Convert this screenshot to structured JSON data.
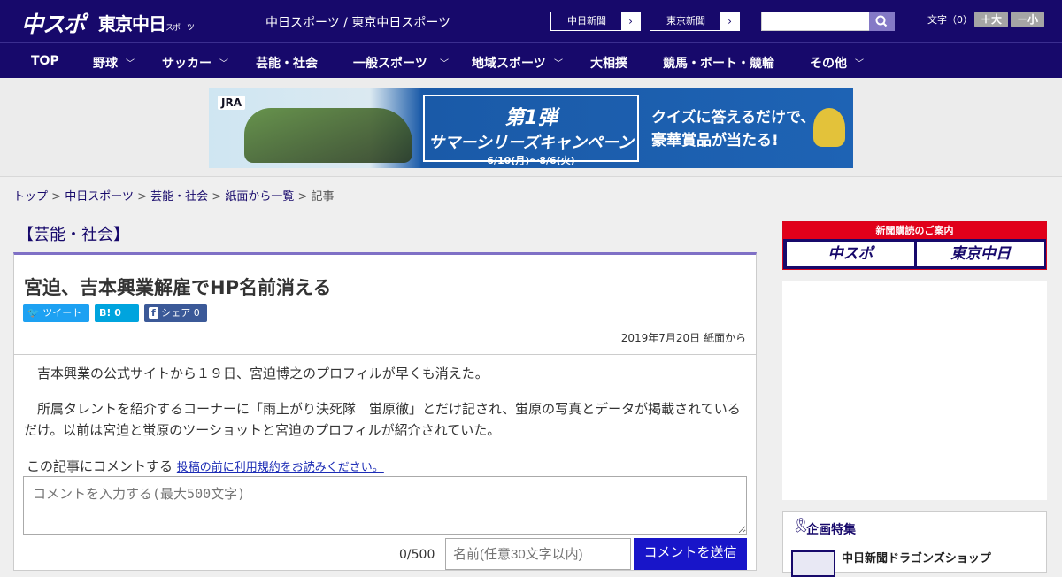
{
  "header": {
    "logo_main": "中スポ",
    "logo_sub": "東京中日",
    "logo_sub_small": "スポーツ",
    "site_line": "中日スポーツ / 東京中日スポーツ",
    "ext_links": [
      {
        "label": "中日新聞",
        "arrow": "›"
      },
      {
        "label": "東京新聞",
        "arrow": "›"
      }
    ],
    "search_placeholder": "",
    "font_size_label": "文字（0）",
    "font_larger": "＋大",
    "font_smaller": "－小"
  },
  "nav": {
    "items": [
      {
        "label": "TOP",
        "has_menu": false
      },
      {
        "label": "野球",
        "has_menu": true
      },
      {
        "label": "サッカー",
        "has_menu": true
      },
      {
        "label": "芸能・社会",
        "has_menu": false
      },
      {
        "label": "一般スポーツ",
        "has_menu": true
      },
      {
        "label": "地域スポーツ",
        "has_menu": true
      },
      {
        "label": "大相撲",
        "has_menu": false
      },
      {
        "label": "競馬・ボート・競輪",
        "has_menu": false
      },
      {
        "label": "その他",
        "has_menu": true
      }
    ]
  },
  "ad_banner": {
    "jra": "JRA",
    "campaign_line1": "第1弾",
    "campaign_line2": "サマーシリーズキャンペーン",
    "campaign_dates": "6/10(月)～8/6(火)",
    "quiz_line1": "クイズに答えるだけで、",
    "quiz_line2": "豪華賞品が当たる!"
  },
  "breadcrumb": {
    "items": [
      "トップ",
      "中日スポーツ",
      "芸能・社会",
      "紙面から一覧"
    ],
    "current": "記事",
    "sep": ">"
  },
  "article": {
    "category": "【芸能・社会】",
    "title": "宮迫、吉本興業解雇でHP名前消える",
    "tweet_label": "ツイート",
    "hatena_label": "B! 0",
    "facebook_label": "シェア 0",
    "date": "2019年7月20日 紙面から",
    "paragraphs": [
      "　吉本興業の公式サイトから１９日、宮迫博之のプロフィルが早くも消えた。",
      "　所属タレントを紹介するコーナーに「雨上がり決死隊　蛍原徹」とだけ記され、蛍原の写真とデータが掲載されているだけ。以前は宮迫と蛍原のツーショットと宮迫のプロフィルが紹介されていた。"
    ]
  },
  "comments": {
    "label": "この記事にコメントする",
    "terms_link": "投稿の前に利用規約をお読みください。",
    "placeholder": "コメントを入力する(最大500文字)",
    "count": "0/500",
    "name_placeholder": "名前(任意30文字以内)",
    "submit_label": "コメントを送信"
  },
  "sidebar": {
    "subscribe_header": "新聞購読のご案内",
    "subscribe_left": "中スポ",
    "subscribe_right": "東京中日",
    "feature_title": "企画特集",
    "feature_item": "中日新聞ドラゴンズショップ"
  },
  "colors": {
    "brand": "#17096b",
    "accent": "#7f70c6",
    "red": "#e1001a",
    "send": "#1815c9"
  }
}
